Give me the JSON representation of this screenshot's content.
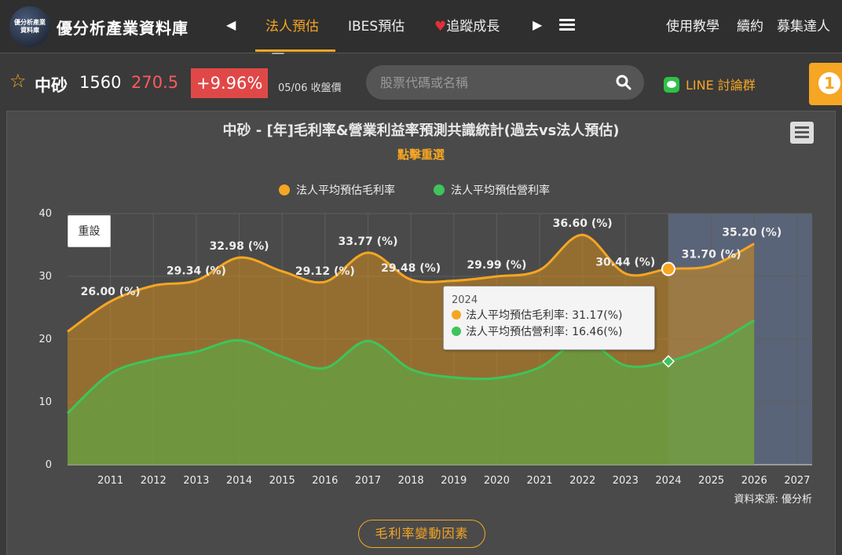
{
  "header": {
    "logo_text": "優分析產業資料庫",
    "site_title": "優分析產業資料庫",
    "nav": [
      {
        "label": "法人預估",
        "active": true
      },
      {
        "label": "IBES預估",
        "active": false
      },
      {
        "label": "追蹤成長",
        "active": false
      }
    ],
    "right_links": [
      "使用教學",
      "續約",
      "募集達人"
    ]
  },
  "stock": {
    "name": "中砂",
    "code": "1560",
    "price": "270.5",
    "change": "+9.96%",
    "date_label": "05/06 收盤價",
    "search_placeholder": "股票代碼或名稱",
    "line_label": "LINE 討論群",
    "notification_count": "1"
  },
  "colors": {
    "accent": "#f5a623",
    "gross": "#f5a623",
    "operating": "#3ec45a",
    "up": "#e04848"
  },
  "chart": {
    "reset_label": "重設",
    "source": "資料來源: 優分析",
    "factor_button": "毛利率變動因素",
    "tooltip": {
      "year": "2024",
      "rows": [
        {
          "label": "法人平均預估毛利率: 31.17(%)",
          "color": "#f5a623"
        },
        {
          "label": "法人平均預估營利率: 16.46(%)",
          "color": "#3ec45a"
        }
      ]
    }
  },
  "chart_data": {
    "type": "area",
    "title": "中砂 - [年]毛利率&營業利益率預測共識統計(過去vs法人預估)",
    "subtitle": "點擊重選",
    "x": [
      2010,
      2011,
      2012,
      2013,
      2014,
      2015,
      2016,
      2017,
      2018,
      2019,
      2020,
      2021,
      2022,
      2023,
      2024,
      2025,
      2026
    ],
    "xticks": [
      2011,
      2012,
      2013,
      2014,
      2015,
      2016,
      2017,
      2018,
      2019,
      2020,
      2021,
      2022,
      2023,
      2024,
      2025,
      2026,
      2027
    ],
    "ylim": [
      0,
      40
    ],
    "yticks": [
      0,
      10,
      20,
      30,
      40
    ],
    "forecast_from": 2024,
    "series": [
      {
        "name": "法人平均預估毛利率",
        "color": "#f5a623",
        "values": [
          21.2,
          26.0,
          28.5,
          29.34,
          32.98,
          30.8,
          29.12,
          33.77,
          29.48,
          29.3,
          29.99,
          31.0,
          36.6,
          30.44,
          31.17,
          31.7,
          35.2
        ],
        "label_years": [
          2011,
          2013,
          2014,
          2016,
          2017,
          2018,
          2020,
          2022,
          2023,
          2025,
          2026
        ],
        "labels": [
          "26.00 (%)",
          "29.34 (%)",
          "32.98 (%)",
          "29.12 (%)",
          "33.77 (%)",
          "29.48 (%)",
          "29.99 (%)",
          "36.60 (%)",
          "30.44 (%)",
          "31.70 (%)",
          "35.20 (%)"
        ]
      },
      {
        "name": "法人平均預估營利率",
        "color": "#3ec45a",
        "values": [
          8.2,
          14.5,
          16.8,
          18.0,
          19.8,
          17.2,
          15.4,
          19.7,
          15.2,
          13.9,
          13.8,
          15.5,
          19.8,
          15.8,
          16.46,
          19.0,
          23.0
        ]
      }
    ],
    "highlight_x": 2024,
    "legend": "top-center",
    "grid": true
  }
}
